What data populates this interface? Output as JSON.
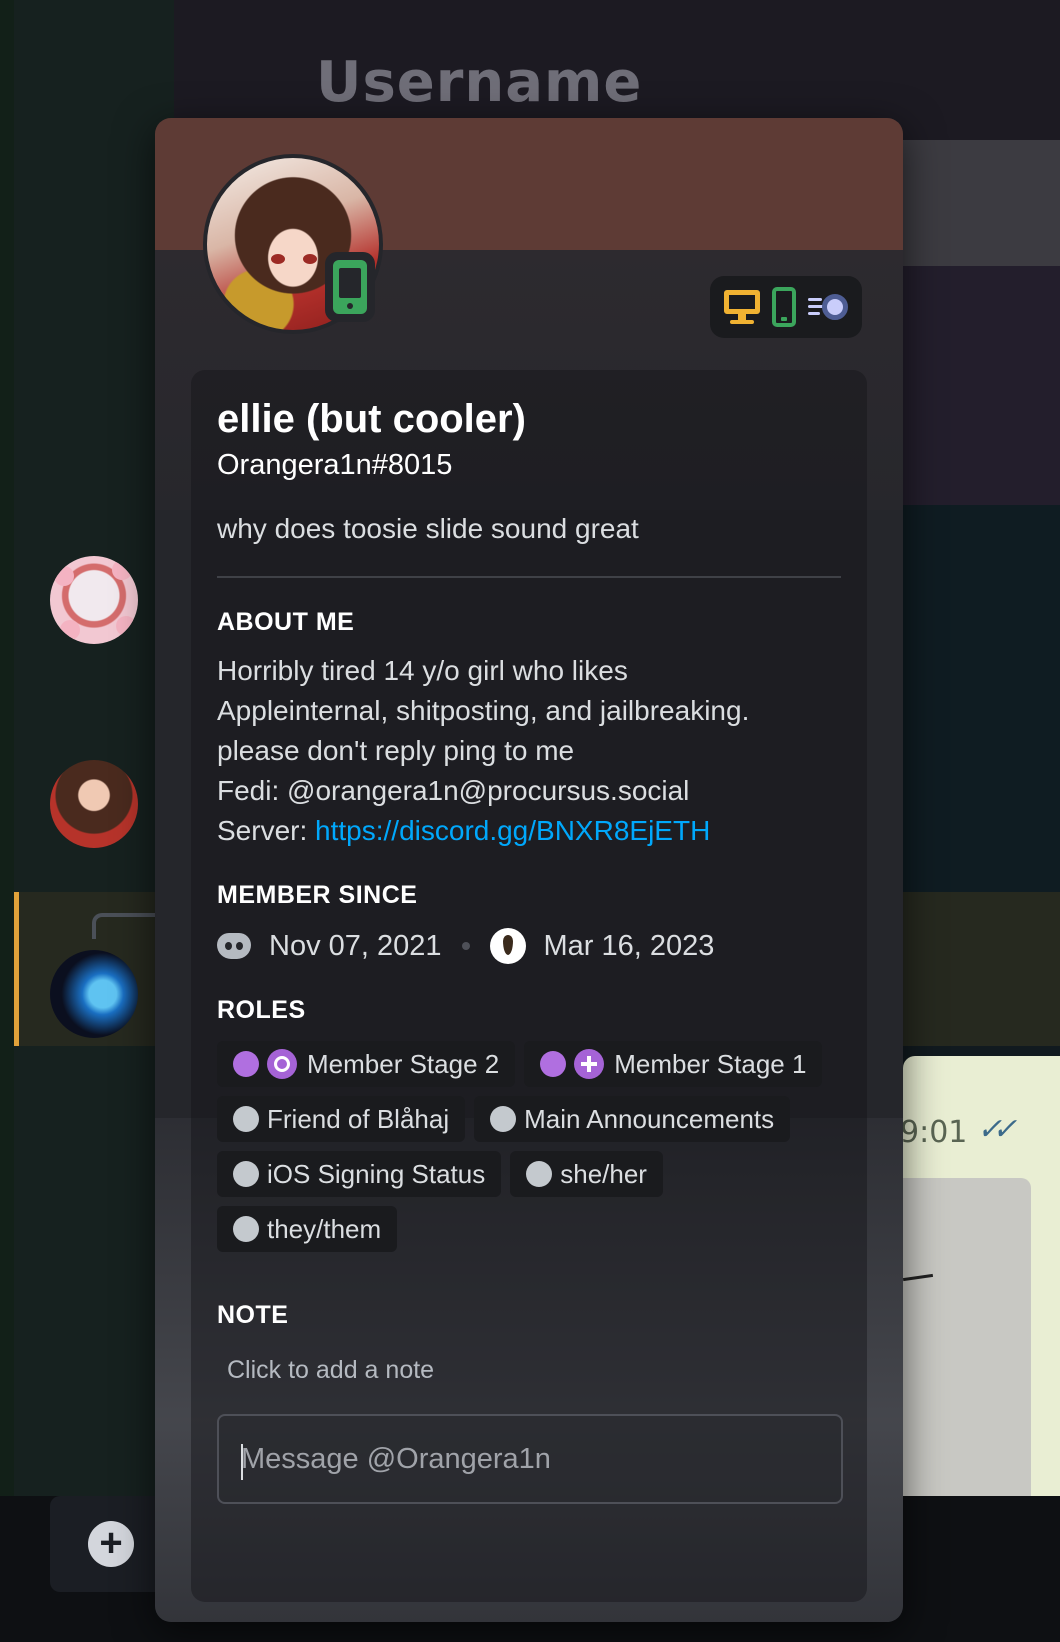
{
  "background": {
    "channel_header_title": "Username",
    "chat_timestamp": "9:01",
    "read_receipt": "✓✓",
    "add_button_symbol": "+"
  },
  "profile": {
    "banner_color": "#5e3b35",
    "avatar_status": "mobile-online",
    "device_badges": [
      "desktop-icon",
      "mobile-icon",
      "nitro-icon"
    ],
    "display_name": "ellie (but cooler)",
    "user_tag": "Orangera1n#8015",
    "custom_status": "why does toosie slide sound great",
    "about_me": {
      "title": "About Me",
      "lines": [
        "Horribly tired 14 y/o girl who likes",
        "Appleinternal, shitposting, and jailbreaking.",
        "please don't reply ping to me",
        "Fedi: @orangera1n@procursus.social"
      ],
      "server_label": "Server: ",
      "server_link": "https://discord.gg/BNXR8EjETH"
    },
    "member_since": {
      "title": "Member Since",
      "discord_date": "Nov 07, 2021",
      "server_date": "Mar 16, 2023"
    },
    "roles": {
      "title": "Roles",
      "items": [
        {
          "name": "Member Stage 2",
          "color": "#b06fe0",
          "icon": "ring"
        },
        {
          "name": "Member Stage 1",
          "color": "#b06fe0",
          "icon": "plus"
        },
        {
          "name": "Friend of Blåhaj",
          "color": "#c4c9ce"
        },
        {
          "name": "Main Announcements",
          "color": "#c4c9ce"
        },
        {
          "name": "iOS Signing Status",
          "color": "#c4c9ce"
        },
        {
          "name": "she/her",
          "color": "#c4c9ce"
        },
        {
          "name": "they/them",
          "color": "#c4c9ce"
        }
      ]
    },
    "note": {
      "title": "Note",
      "placeholder": "Click to add a note"
    },
    "message": {
      "placeholder": "Message @Orangera1n"
    }
  }
}
